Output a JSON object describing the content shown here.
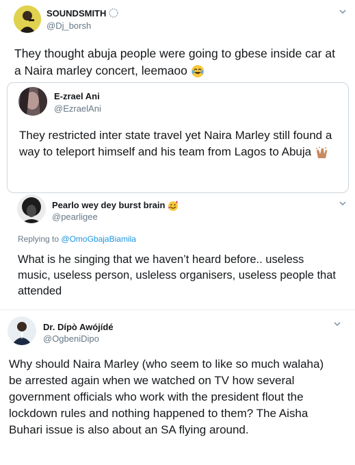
{
  "tweets": [
    {
      "name": "SOUNDSMITH",
      "handle": "@Dj_borsh",
      "text": "They thought abuja people were going to gbese inside car at a Naira marley concert, leemaoo",
      "emoji": "tears-of-joy-emoji"
    },
    {
      "name": "E-zrael Ani",
      "handle": "@EzraelAni",
      "text": "They restricted inter state travel yet Naira Marley still found a way to teleport himself and his team from Lagos to Abuja",
      "emoji": "clapping-hands-emoji"
    },
    {
      "name": "Pearlo wey dey burst brain",
      "handle": "@pearligee",
      "replying_label": "Replying to",
      "replying_handle": "@OmoGbajaBiamila",
      "text": "What is he singing that we haven’t heard before.. useless music, useless person, usleless organisers, useless people that attended",
      "emoji": "smiling-face-with-hearts-emoji"
    },
    {
      "name": "Dr. Dípò Awójídé",
      "handle": "@OgbeniDipo",
      "text": "Why should Naira Marley (who seem to like so much walaha) be arrested again when we watched on TV how several government officials who work with the president flout the lockdown rules and nothing happened to them? The Aisha Buhari issue is also about an SA flying around."
    }
  ],
  "colors": {
    "link": "#1b95e0",
    "secondary": "#657786",
    "border": "#ccd6dd"
  }
}
